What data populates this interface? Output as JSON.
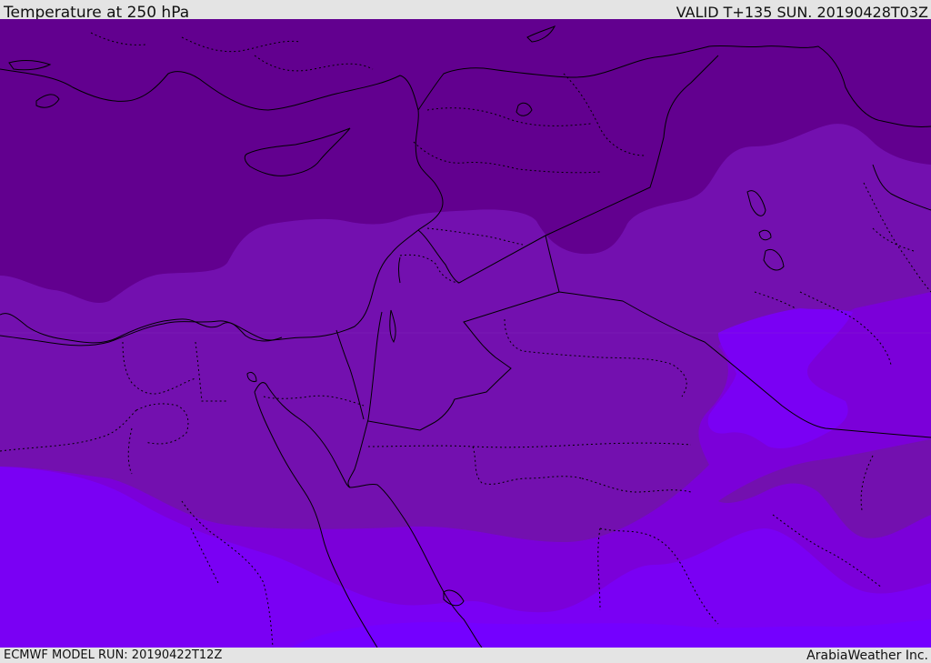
{
  "header": {
    "title": "Temperature at 250 hPa",
    "valid_time": "VALID T+135 SUN. 20190428T03Z"
  },
  "footer": {
    "model_run": "ECMWF MODEL RUN: 20190422T12Z",
    "credit": "ArabiaWeather Inc."
  },
  "map": {
    "field": "temperature_250hPa",
    "region": "Eastern Mediterranean and Middle East",
    "band_colors": {
      "coldest": "#62008f",
      "cold": "#7310af",
      "mid": "#7b00d9",
      "warm": "#7a00f4",
      "warmest": "#7400ff"
    },
    "overlays": [
      "coastlines",
      "country-borders",
      "province-borders"
    ]
  }
}
